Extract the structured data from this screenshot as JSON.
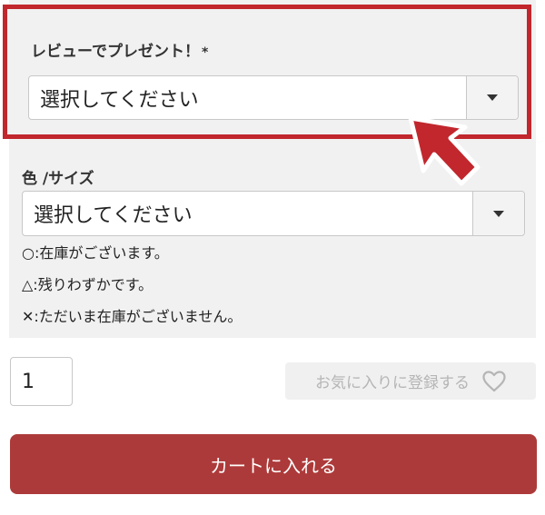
{
  "review_gift": {
    "label": "レビューでプレゼント！",
    "required_mark": "*",
    "select_value": "選択してください"
  },
  "color_size": {
    "label": "色 /サイズ",
    "select_value": "選択してください",
    "notes": [
      "○:在庫がございます。",
      "△:残りわずかです。",
      "✕:ただいま在庫がございません。"
    ]
  },
  "quantity": {
    "value": "1"
  },
  "favorite": {
    "label": "お気に入りに登録する",
    "icon": "heart-icon"
  },
  "cart": {
    "label": "カートに入れる"
  },
  "colors": {
    "highlight": "#c1272d",
    "cart_button": "#ad3a3a",
    "panel": "#f1f1f1"
  }
}
